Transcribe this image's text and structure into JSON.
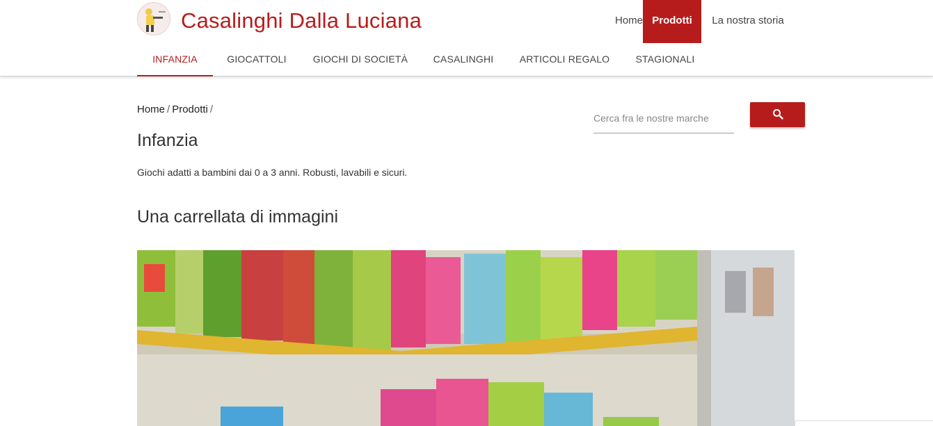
{
  "header": {
    "brand": "Casalinghi Dalla Luciana",
    "top_nav": [
      {
        "label": "Home"
      },
      {
        "label": "Prodotti",
        "active": true
      },
      {
        "label": "La nostra storia"
      }
    ],
    "categories": [
      {
        "label": "Infanzia",
        "active": true
      },
      {
        "label": "Giocattoli"
      },
      {
        "label": "Giochi di società"
      },
      {
        "label": "Casalinghi"
      },
      {
        "label": "Articoli regalo"
      },
      {
        "label": "Stagionali"
      }
    ]
  },
  "breadcrumb": {
    "items": [
      "Home",
      "Prodotti"
    ],
    "separator": "/"
  },
  "page": {
    "title": "Infanzia",
    "description": "Giochi adatti a bambini dai 0 a 3 anni. Robusti, lavabili e sicuri.",
    "section_title": "Una carrellata di immagini"
  },
  "search": {
    "placeholder": "Cerca fra le nostre marche",
    "value": "",
    "icon": "search-icon"
  },
  "colors": {
    "accent": "#b71c1c",
    "text": "#333333"
  }
}
